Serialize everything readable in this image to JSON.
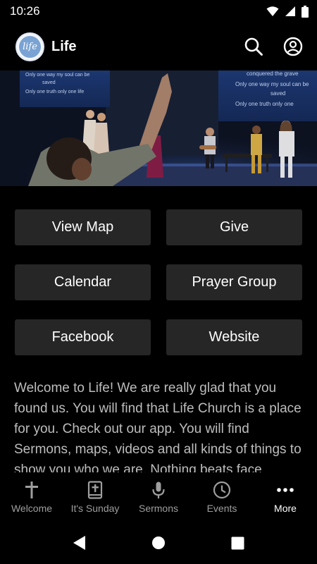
{
  "status_bar": {
    "time": "10:26",
    "icons": [
      "wifi-icon",
      "signal-icon",
      "battery-icon"
    ]
  },
  "app_bar": {
    "logo_text": "life",
    "title": "Life",
    "actions": [
      "search-icon",
      "account-icon"
    ]
  },
  "hero": {
    "screen_left_lines": [
      "Only one way my soul can be",
      "saved",
      "Only one truth only one life"
    ],
    "screen_right_lines": [
      "conquered the grave",
      "Only one way my soul can be",
      "saved",
      "Only one truth only one"
    ]
  },
  "buttons": [
    {
      "label": "View Map"
    },
    {
      "label": "Give"
    },
    {
      "label": "Calendar"
    },
    {
      "label": "Prayer Group"
    },
    {
      "label": "Facebook"
    },
    {
      "label": "Website"
    }
  ],
  "welcome_text": "Welcome to Life! We are really glad that you found us. You will find that Life Church is a place for you. Check out our app. You will find Sermons, maps, videos and all kinds of things to show you who we are. Nothing beats face",
  "bottom_nav": {
    "active_index": 4,
    "items": [
      {
        "label": "Welcome",
        "icon": "cross-icon"
      },
      {
        "label": "It's Sunday",
        "icon": "bible-icon"
      },
      {
        "label": "Sermons",
        "icon": "microphone-icon"
      },
      {
        "label": "Events",
        "icon": "clock-icon"
      },
      {
        "label": "More",
        "icon": "more-icon"
      }
    ]
  },
  "colors": {
    "background": "#000000",
    "tile": "#262626",
    "body_text": "#bdbdbd",
    "nav_inactive": "#9e9e9e",
    "logo_accent": "#7aa3d4"
  }
}
